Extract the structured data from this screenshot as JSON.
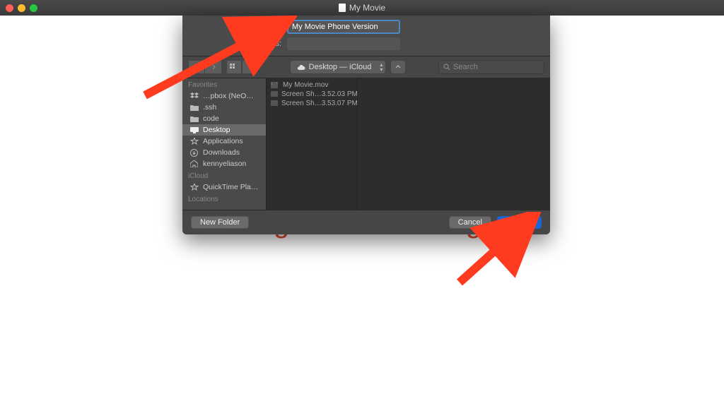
{
  "window": {
    "title": "My Movie"
  },
  "export": {
    "label": "Export As:",
    "value": "My Movie Phone Version",
    "tags_label": "Tags:"
  },
  "toolbar": {
    "location": "Desktop — iCloud",
    "search_placeholder": "Search"
  },
  "sidebar": {
    "sections": {
      "favorites": "Favorites",
      "icloud": "iCloud",
      "locations": "Locations"
    },
    "favorites": [
      {
        "label": "…pbox (NeO…",
        "icon": "dropbox"
      },
      {
        "label": ".ssh",
        "icon": "folder"
      },
      {
        "label": "code",
        "icon": "folder"
      },
      {
        "label": "Desktop",
        "icon": "desktop",
        "selected": true
      },
      {
        "label": "Applications",
        "icon": "apps"
      },
      {
        "label": "Downloads",
        "icon": "downloads"
      },
      {
        "label": "kennyeliason",
        "icon": "home"
      }
    ],
    "icloud_items": [
      {
        "label": "QuickTime Pla…",
        "icon": "apps"
      }
    ]
  },
  "files": [
    {
      "name": "My Movie.mov",
      "kind": "mov"
    },
    {
      "name": "Screen Sh…3.52.03 PM",
      "kind": "img"
    },
    {
      "name": "Screen Sh…3.53.07 PM",
      "kind": "img",
      "cloud": true
    }
  ],
  "buttons": {
    "new_folder": "New Folder",
    "cancel": "Cancel",
    "save": "Save"
  },
  "background_text": "doing incredible things.",
  "annotation_arrows": 2
}
